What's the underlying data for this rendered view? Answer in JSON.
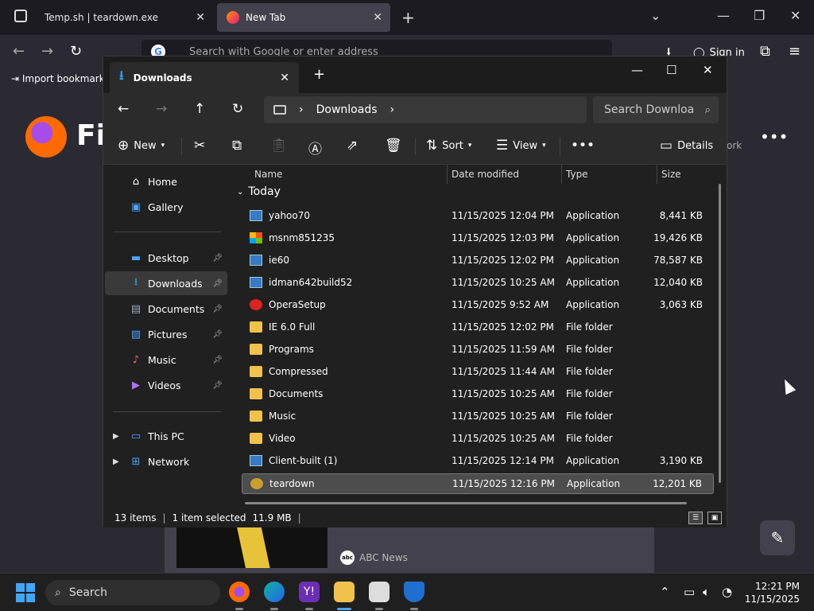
{
  "firefox": {
    "tabs": [
      {
        "label": "Temp.sh | teardown.exe"
      },
      {
        "label": "New Tab"
      }
    ],
    "url_placeholder": "Search with Google or enter address",
    "sign_in": "Sign in",
    "bookmark": "Import bookmarks",
    "logo_text": "Fi",
    "work_text": "ork",
    "news_source": "ABC News"
  },
  "explorer": {
    "tab_title": "Downloads",
    "breadcrumb": "Downloads",
    "search_placeholder": "Search Downloa",
    "toolbar": {
      "new": "New",
      "sort": "Sort",
      "view": "View",
      "details": "Details"
    },
    "nav": [
      {
        "label": "Home"
      },
      {
        "label": "Gallery"
      },
      {
        "label": "Desktop"
      },
      {
        "label": "Downloads"
      },
      {
        "label": "Documents"
      },
      {
        "label": "Pictures"
      },
      {
        "label": "Music"
      },
      {
        "label": "Videos"
      },
      {
        "label": "This PC"
      },
      {
        "label": "Network"
      }
    ],
    "columns": {
      "name": "Name",
      "date": "Date modified",
      "type": "Type",
      "size": "Size"
    },
    "group": "Today",
    "files": [
      {
        "name": "yahoo70",
        "date": "11/15/2025 12:04 PM",
        "type": "Application",
        "size": "8,441 KB",
        "icon": "app"
      },
      {
        "name": "msnm851235",
        "date": "11/15/2025 12:03 PM",
        "type": "Application",
        "size": "19,426 KB",
        "icon": "ms"
      },
      {
        "name": "ie60",
        "date": "11/15/2025 12:02 PM",
        "type": "Application",
        "size": "78,587 KB",
        "icon": "app"
      },
      {
        "name": "idman642build52",
        "date": "11/15/2025 10:25 AM",
        "type": "Application",
        "size": "12,040 KB",
        "icon": "app"
      },
      {
        "name": "OperaSetup",
        "date": "11/15/2025 9:52 AM",
        "type": "Application",
        "size": "3,063 KB",
        "icon": "opera"
      },
      {
        "name": "IE 6.0 Full",
        "date": "11/15/2025 12:02 PM",
        "type": "File folder",
        "size": "",
        "icon": "folder"
      },
      {
        "name": "Programs",
        "date": "11/15/2025 11:59 AM",
        "type": "File folder",
        "size": "",
        "icon": "folder"
      },
      {
        "name": "Compressed",
        "date": "11/15/2025 11:44 AM",
        "type": "File folder",
        "size": "",
        "icon": "folder"
      },
      {
        "name": "Documents",
        "date": "11/15/2025 10:25 AM",
        "type": "File folder",
        "size": "",
        "icon": "folder"
      },
      {
        "name": "Music",
        "date": "11/15/2025 10:25 AM",
        "type": "File folder",
        "size": "",
        "icon": "folder"
      },
      {
        "name": "Video",
        "date": "11/15/2025 10:25 AM",
        "type": "File folder",
        "size": "",
        "icon": "folder"
      },
      {
        "name": "Client-built (1)",
        "date": "11/15/2025 12:14 PM",
        "type": "Application",
        "size": "3,190 KB",
        "icon": "app"
      },
      {
        "name": "teardown",
        "date": "11/15/2025 12:16 PM",
        "type": "Application",
        "size": "12,201 KB",
        "icon": "td"
      }
    ],
    "status": {
      "items": "13 items",
      "selected": "1 item selected",
      "size": "11.9 MB"
    }
  },
  "taskbar": {
    "search": "Search",
    "time": "12:21 PM",
    "date": "11/15/2025"
  }
}
